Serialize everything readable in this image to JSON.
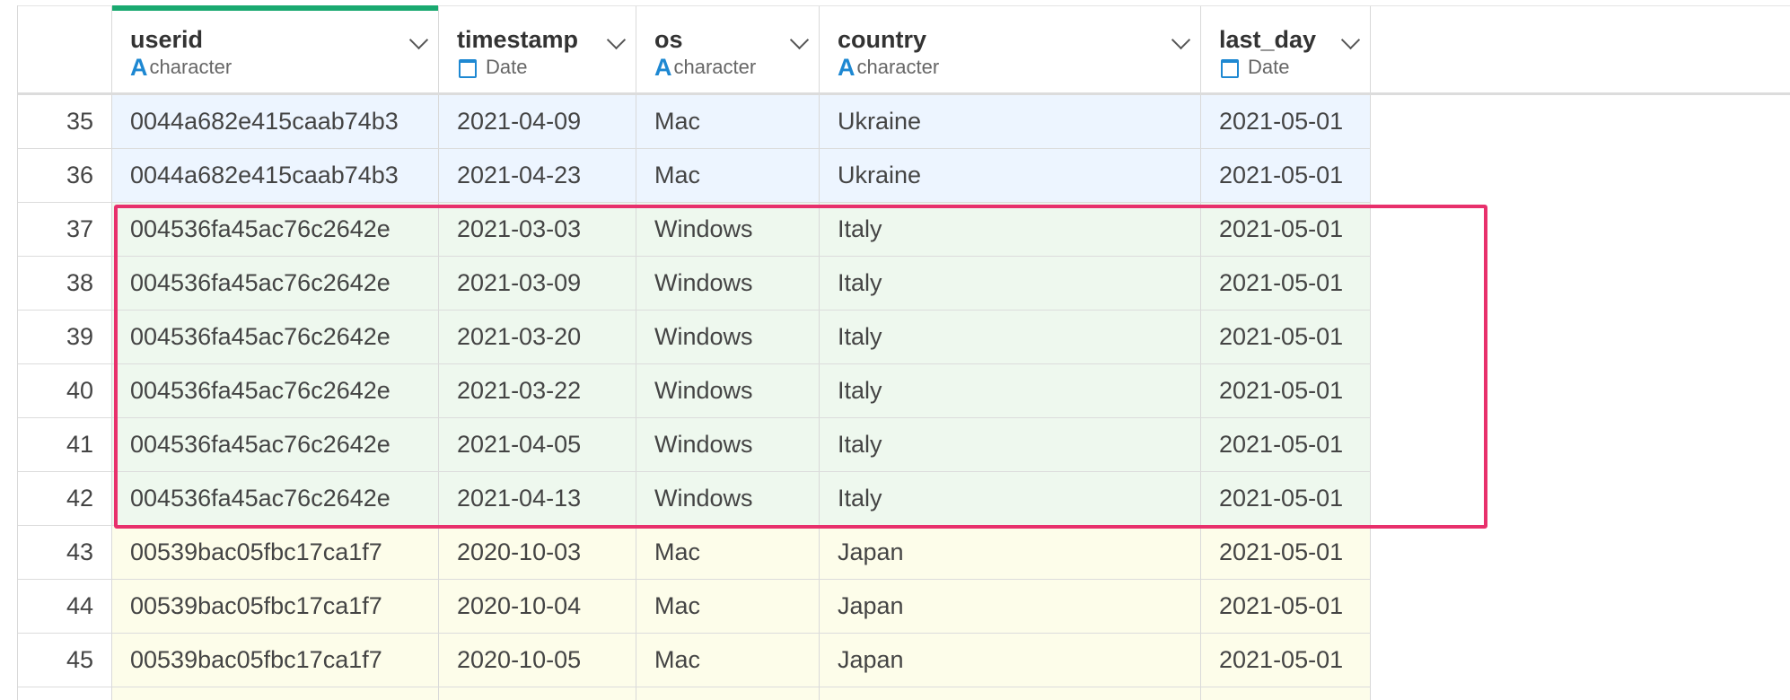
{
  "columns": [
    {
      "name": "userid",
      "type": "character",
      "type_icon": "A"
    },
    {
      "name": "timestamp",
      "type": "Date",
      "type_icon": "calendar-icon"
    },
    {
      "name": "os",
      "type": "character",
      "type_icon": "A"
    },
    {
      "name": "country",
      "type": "character",
      "type_icon": "A"
    },
    {
      "name": "last_day",
      "type": "Date",
      "type_icon": "calendar-icon"
    }
  ],
  "rows": [
    {
      "num": "35",
      "userid": "0044a682e415caab74b3",
      "timestamp": "2021-04-09",
      "os": "Mac",
      "country": "Ukraine",
      "last_day": "2021-05-01"
    },
    {
      "num": "36",
      "userid": "0044a682e415caab74b3",
      "timestamp": "2021-04-23",
      "os": "Mac",
      "country": "Ukraine",
      "last_day": "2021-05-01"
    },
    {
      "num": "37",
      "userid": "004536fa45ac76c2642e",
      "timestamp": "2021-03-03",
      "os": "Windows",
      "country": "Italy",
      "last_day": "2021-05-01"
    },
    {
      "num": "38",
      "userid": "004536fa45ac76c2642e",
      "timestamp": "2021-03-09",
      "os": "Windows",
      "country": "Italy",
      "last_day": "2021-05-01"
    },
    {
      "num": "39",
      "userid": "004536fa45ac76c2642e",
      "timestamp": "2021-03-20",
      "os": "Windows",
      "country": "Italy",
      "last_day": "2021-05-01"
    },
    {
      "num": "40",
      "userid": "004536fa45ac76c2642e",
      "timestamp": "2021-03-22",
      "os": "Windows",
      "country": "Italy",
      "last_day": "2021-05-01"
    },
    {
      "num": "41",
      "userid": "004536fa45ac76c2642e",
      "timestamp": "2021-04-05",
      "os": "Windows",
      "country": "Italy",
      "last_day": "2021-05-01"
    },
    {
      "num": "42",
      "userid": "004536fa45ac76c2642e",
      "timestamp": "2021-04-13",
      "os": "Windows",
      "country": "Italy",
      "last_day": "2021-05-01"
    },
    {
      "num": "43",
      "userid": "00539bac05fbc17ca1f7",
      "timestamp": "2020-10-03",
      "os": "Mac",
      "country": "Japan",
      "last_day": "2021-05-01"
    },
    {
      "num": "44",
      "userid": "00539bac05fbc17ca1f7",
      "timestamp": "2020-10-04",
      "os": "Mac",
      "country": "Japan",
      "last_day": "2021-05-01"
    },
    {
      "num": "45",
      "userid": "00539bac05fbc17ca1f7",
      "timestamp": "2020-10-05",
      "os": "Mac",
      "country": "Japan",
      "last_day": "2021-05-01"
    }
  ],
  "colors": {
    "group_ukraine": "#edf5ff",
    "group_italy": "#eef8ee",
    "group_japan": "#fdfdea",
    "highlight_border": "#e8306c",
    "active_column_bar": "#1aa970",
    "type_icon": "#1e88d2"
  }
}
